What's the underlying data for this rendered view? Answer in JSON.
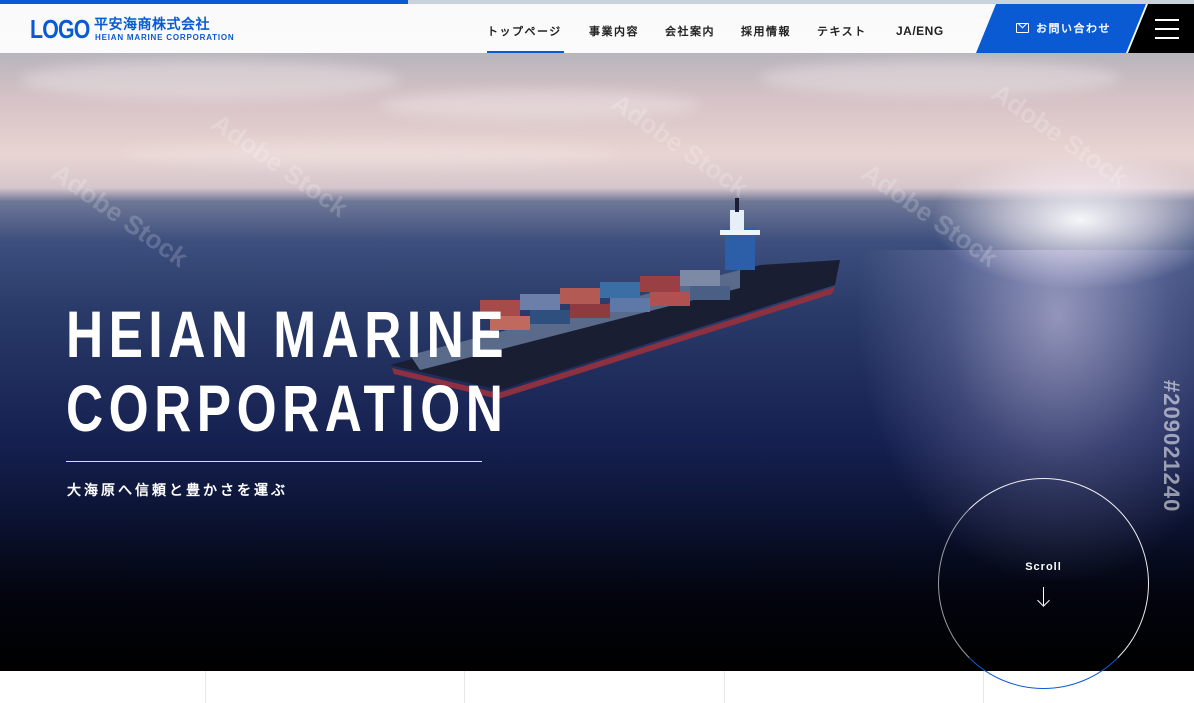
{
  "logo": {
    "word": "LOGO",
    "company_jp": "平安海商株式会社",
    "company_en": "HEIAN MARINE CORPORATION"
  },
  "nav": {
    "items": [
      {
        "label": "トップページ",
        "active": true
      },
      {
        "label": "事業内容"
      },
      {
        "label": "会社案内"
      },
      {
        "label": "採用情報"
      },
      {
        "label": "テキスト"
      }
    ],
    "lang": "JA/ENG"
  },
  "contact": {
    "label": "お問い合わせ",
    "icon": "mail-icon"
  },
  "menu": {
    "icon": "hamburger-icon"
  },
  "hero": {
    "title_line1": "HEIAN MARINE",
    "title_line2": "CORPORATION",
    "subtitle": "大海原へ信頼と豊かさを運ぶ",
    "side_code": "#209021240",
    "watermark": "Adobe Stock"
  },
  "scroll": {
    "label": "Scroll",
    "icon": "arrow-down-icon"
  },
  "colors": {
    "accent": "#0a5bd3",
    "dark": "#000000"
  }
}
